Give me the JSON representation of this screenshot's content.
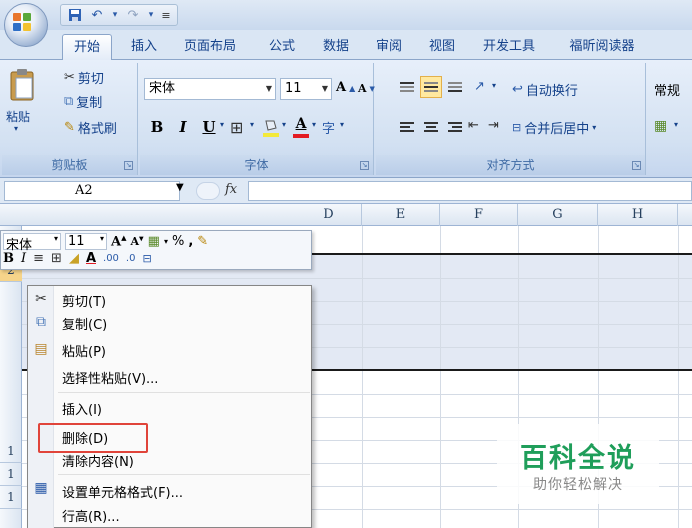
{
  "quick_access": {
    "save": "save-icon",
    "undo": "undo-icon",
    "redo": "redo-icon"
  },
  "tabs": [
    "开始",
    "插入",
    "页面布局",
    "公式",
    "数据",
    "审阅",
    "视图",
    "开发工具",
    "福昕阅读器"
  ],
  "clipboard": {
    "paste": "粘贴",
    "cut": "剪切",
    "copy": "复制",
    "format_painter": "格式刷",
    "label": "剪贴板"
  },
  "font_group": {
    "font_name": "宋体",
    "font_size": "11",
    "label": "字体",
    "bold": "B",
    "italic": "I",
    "underline": "U"
  },
  "alignment_group": {
    "wrap_text": "自动换行",
    "merge_center": "合并后居中",
    "label": "对齐方式"
  },
  "number_group": {
    "format": "常规"
  },
  "name_box": "A2",
  "fx_label": "fx",
  "columns": [
    "D",
    "E",
    "F",
    "G",
    "H"
  ],
  "rows": [
    "2",
    "1",
    "1",
    "1"
  ],
  "mini_toolbar": {
    "font_name": "宋体",
    "font_size": "11",
    "percent": "%",
    "comma": ","
  },
  "context_menu": [
    {
      "label": "剪切(T)",
      "icon": "scissors-icon"
    },
    {
      "label": "复制(C)",
      "icon": "copy-icon"
    },
    {
      "label": "粘贴(P)",
      "icon": "paste-icon"
    },
    {
      "label": "选择性粘贴(V)...",
      "icon": ""
    },
    {
      "label": "插入(I)",
      "icon": ""
    },
    {
      "label": "删除(D)",
      "icon": ""
    },
    {
      "label": "清除内容(N)",
      "icon": ""
    },
    {
      "label": "设置单元格格式(F)...",
      "icon": "format-cells-icon"
    },
    {
      "label": "行高(R)...",
      "icon": ""
    }
  ],
  "watermark": {
    "title": "百科全说",
    "subtitle": "助你轻松解决"
  },
  "colors": {
    "highlight_border": "#e0443a",
    "watermark_green": "#1f9e5a",
    "ribbon_text": "#15428b"
  }
}
